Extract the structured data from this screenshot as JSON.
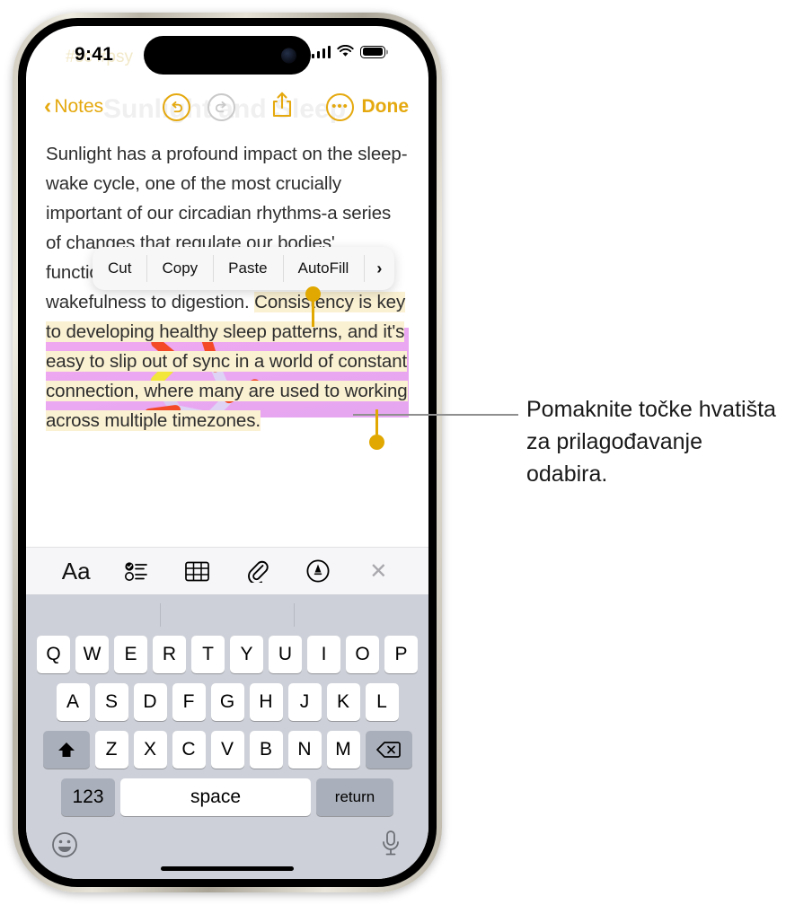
{
  "status_bar": {
    "time": "9:41",
    "cellular_icon": "signal-bars-icon",
    "wifi_icon": "wifi-icon",
    "battery_icon": "battery-full-icon"
  },
  "ghost_content": {
    "tags": "#sc      #psy",
    "title": "Sunlight and Sleep"
  },
  "nav_bar": {
    "back_label": "Notes",
    "back_chevron": "chevron-left-icon",
    "undo_icon": "undo-arrow-icon",
    "redo_icon": "redo-arrow-icon",
    "share_icon": "share-up-arrow-icon",
    "more_icon": "ellipsis-circle-icon",
    "more_glyph": "•••",
    "done_label": "Done",
    "accent_color": "#E5A90F"
  },
  "note": {
    "paragraph_before": "Sunlight has a profound impact on the sleep-wake cycle, one of the most crucially important of our circadian rhythms-a series of ",
    "paragraph_obscured": "changes that regulate our bodies' functions to optimize everything from wakefulness to digestion. ",
    "selected_text": "Consistency is key to developing healthy sleep patterns, and it's easy to slip out of sync in a world of constant connection, where many are used to working across multiple timezones.",
    "highlight_color": "#FAF0D2",
    "attachment_name": "molecule-image"
  },
  "context_menu": {
    "items": [
      {
        "label": "Cut"
      },
      {
        "label": "Copy"
      },
      {
        "label": "Paste"
      },
      {
        "label": "AutoFill"
      }
    ],
    "more_glyph": "›"
  },
  "selection": {
    "handle_color": "#E0A800",
    "start_handle": "selection-start-handle",
    "end_handle": "selection-end-handle"
  },
  "format_toolbar": {
    "items": [
      {
        "name": "text-format-button",
        "glyph": "Aa"
      },
      {
        "name": "checklist-button",
        "glyph": "checklist-icon"
      },
      {
        "name": "table-button",
        "glyph": "table-icon"
      },
      {
        "name": "attachment-button",
        "glyph": "paperclip-icon"
      },
      {
        "name": "markup-button",
        "glyph": "markup-pen-icon"
      },
      {
        "name": "close-toolbar-button",
        "glyph": "✕"
      }
    ]
  },
  "keyboard": {
    "row1": [
      "Q",
      "W",
      "E",
      "R",
      "T",
      "Y",
      "U",
      "I",
      "O",
      "P"
    ],
    "row2": [
      "A",
      "S",
      "D",
      "F",
      "G",
      "H",
      "J",
      "K",
      "L"
    ],
    "row3": [
      "Z",
      "X",
      "C",
      "V",
      "B",
      "N",
      "M"
    ],
    "shift_key": "shift-key",
    "backspace_key": "backspace-key",
    "numbers_key": "123",
    "space_key": "space",
    "return_key": "return",
    "emoji_key": "emoji-icon",
    "mic_key": "microphone-icon"
  },
  "callout": {
    "line1": "Pomaknite točke hvatišta",
    "line2": "za prilagođavanje odabira."
  }
}
